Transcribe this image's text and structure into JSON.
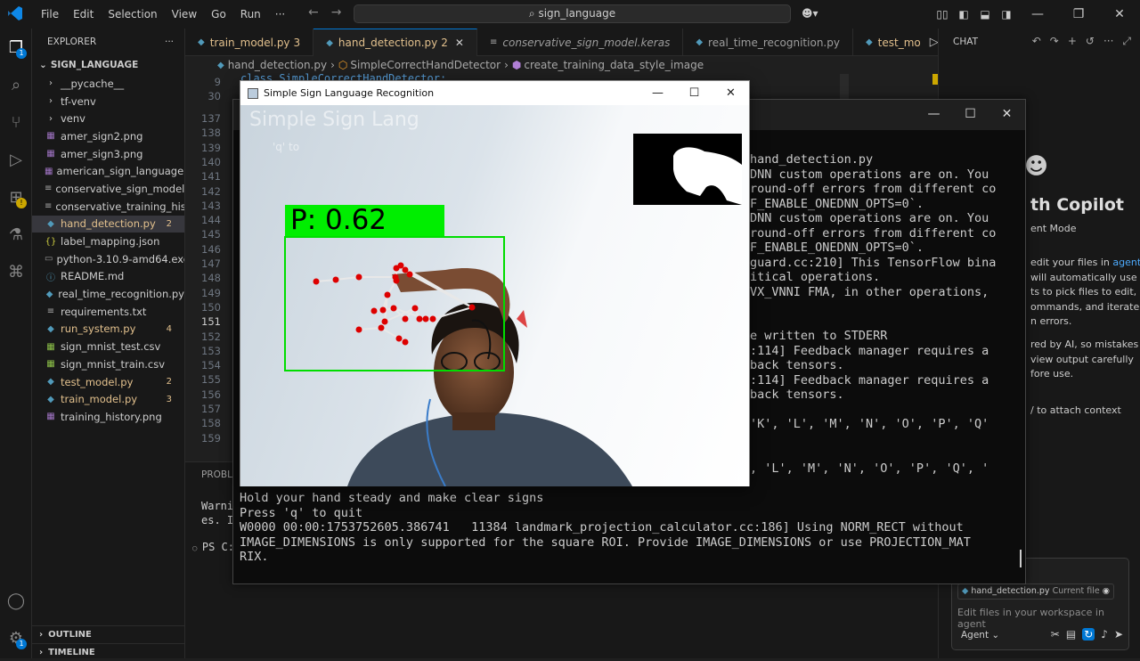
{
  "titlebar": {
    "menus": [
      "File",
      "Edit",
      "Selection",
      "View",
      "Go",
      "Run",
      "···"
    ],
    "search": "sign_language"
  },
  "activity": {
    "explorer_badge": "1",
    "settings_badge": "1"
  },
  "sidebar": {
    "title": "EXPLORER",
    "more": "···",
    "folder": "SIGN_LANGUAGE",
    "items": [
      {
        "name": "__pycache__",
        "type": "folder"
      },
      {
        "name": "tf-venv",
        "type": "folder"
      },
      {
        "name": "venv",
        "type": "folder"
      },
      {
        "name": "amer_sign2.png",
        "type": "image"
      },
      {
        "name": "amer_sign3.png",
        "type": "image"
      },
      {
        "name": "american_sign_language....",
        "type": "image"
      },
      {
        "name": "conservative_sign_model....",
        "type": "file"
      },
      {
        "name": "conservative_training_hist...",
        "type": "file"
      },
      {
        "name": "hand_detection.py",
        "type": "py",
        "count": "2",
        "selected": true,
        "mod": true
      },
      {
        "name": "label_mapping.json",
        "type": "json"
      },
      {
        "name": "python-3.10.9-amd64.exe",
        "type": "exe"
      },
      {
        "name": "README.md",
        "type": "md"
      },
      {
        "name": "real_time_recognition.py",
        "type": "py"
      },
      {
        "name": "requirements.txt",
        "type": "txt"
      },
      {
        "name": "run_system.py",
        "type": "py",
        "count": "4",
        "mod": true
      },
      {
        "name": "sign_mnist_test.csv",
        "type": "csv"
      },
      {
        "name": "sign_mnist_train.csv",
        "type": "csv"
      },
      {
        "name": "test_model.py",
        "type": "py",
        "count": "2",
        "mod": true
      },
      {
        "name": "train_model.py",
        "type": "py",
        "count": "3",
        "mod": true
      },
      {
        "name": "training_history.png",
        "type": "image"
      }
    ],
    "outline": "OUTLINE",
    "timeline": "TIMELINE"
  },
  "tabs": [
    {
      "label": "train_model.py",
      "count": "3"
    },
    {
      "label": "hand_detection.py",
      "count": "2",
      "active": true
    },
    {
      "label": "conservative_sign_model.keras",
      "count": ""
    },
    {
      "label": "real_time_recognition.py",
      "count": ""
    },
    {
      "label": "test_mo",
      "count": ""
    }
  ],
  "breadcrumb": {
    "file": "hand_detection.py",
    "cls": "SimpleCorrectHandDetector",
    "method": "create_training_data_style_image"
  },
  "editor": {
    "sticky": [
      "9",
      "30"
    ],
    "lines": [
      "137",
      "138",
      "139",
      "140",
      "141",
      "142",
      "143",
      "144",
      "145",
      "146",
      "147",
      "148",
      "149",
      "150",
      "151",
      "152",
      "153",
      "154",
      "155",
      "156",
      "157",
      "158",
      "159"
    ],
    "current": "151",
    "sticky_code": "class SimpleCorrectHandDetector:"
  },
  "panel": {
    "tab": "PROBLE",
    "warn1": "Warni",
    "warn2": "es. I",
    "prompt": "PS C:"
  },
  "terminal": {
    "lines": [
      "hand_detection.py",
      "DNN custom operations are on. You",
      "round-off errors from different co",
      "F_ENABLE_ONEDNN_OPTS=0`.",
      "DNN custom operations are on. You",
      "round-off errors from different co",
      "F_ENABLE_ONEDNN_OPTS=0`.",
      "guard.cc:210] This TensorFlow bina",
      "itical operations.",
      "VX_VNNI FMA, in other operations,",
      "",
      "",
      "e written to STDERR",
      ":114] Feedback manager requires a",
      "back tensors.",
      ":114] Feedback manager requires a",
      "back tensors.",
      "",
      "'K', 'L', 'M', 'N', 'O', 'P', 'Q'",
      "",
      "",
      ", 'L', 'M', 'N', 'O', 'P', 'Q', '"
    ],
    "bottom": [
      "Hold your hand steady and make clear signs",
      "Press 'q' to quit",
      "W0000 00:00:1753752605.386741   11384 landmark_projection_calculator.cc:186] Using NORM_RECT without",
      "IMAGE_DIMENSIONS is only supported for the square ROI. Provide IMAGE_DIMENSIONS or use PROJECTION_MAT",
      "RIX."
    ]
  },
  "cv_window": {
    "title": "Simple Sign Language Recognition",
    "overlay_title": "Simple Sign Lang",
    "overlay_sub": "'q' to",
    "prediction": "P: 0.62",
    "colors": {
      "box": "#00dd00",
      "landmark": "#dd0000",
      "connector": "#e8e8e8"
    }
  },
  "chat": {
    "title": "CHAT",
    "heading": "th Copilot",
    "mode_label": "ent Mode",
    "para1a": "edit your files in ",
    "para1link": "agent",
    "para1b": "will automatically use\nts to pick files to edit,\nommands, and iterate\nn errors.",
    "para2": "red by AI, so mistakes\nview output carefully\nfore use.",
    "attach": "/ to attach context",
    "file_chip": "hand_detection.py",
    "file_chip_tag": "Current file",
    "input_placeholder": "Edit files in your workspace in agent",
    "agent_label": "Agent"
  }
}
